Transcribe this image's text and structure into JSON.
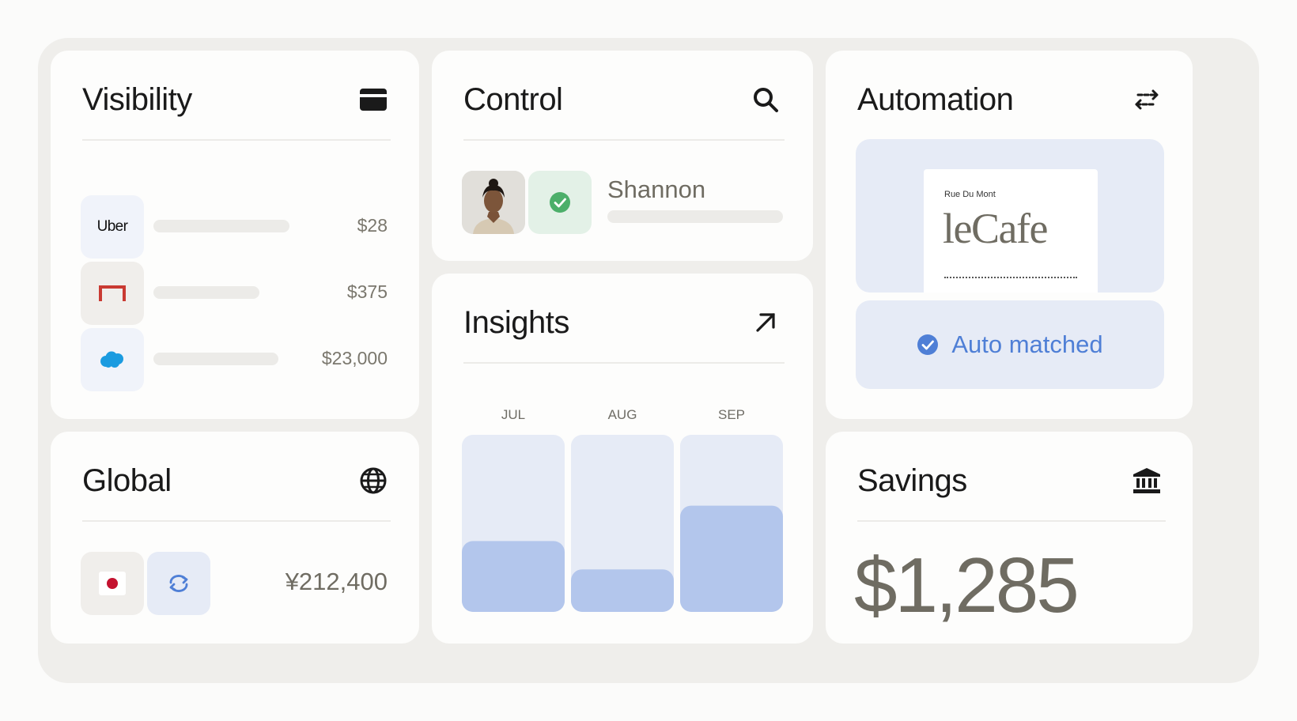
{
  "visibility": {
    "title": "Visibility",
    "icon": "credit-card-icon",
    "rows": [
      {
        "merchant": "Uber",
        "icon": "uber-logo",
        "amount": "$28"
      },
      {
        "merchant": "",
        "icon": "red-bracket-logo",
        "amount": "$375"
      },
      {
        "merchant": "",
        "icon": "salesforce-cloud-logo",
        "amount": "$23,000"
      }
    ]
  },
  "control": {
    "title": "Control",
    "icon": "search-icon",
    "person_name": "Shannon"
  },
  "automation": {
    "title": "Automation",
    "icon": "swap-arrows-icon",
    "receipt_header": "Rue Du Mont",
    "receipt_brand": "leCafe",
    "status": "Auto matched"
  },
  "insights": {
    "title": "Insights",
    "icon": "arrow-up-right-icon"
  },
  "global": {
    "title": "Global",
    "icon": "globe-icon",
    "amount": "¥212,400"
  },
  "savings": {
    "title": "Savings",
    "icon": "bank-icon",
    "amount": "$1,285"
  },
  "colors": {
    "accent_blue": "#4f7fd6",
    "bar_fill": "#b3c6ec",
    "bar_bg": "#e6ebf6",
    "check_green": "#4caf6a"
  },
  "chart_data": {
    "type": "bar",
    "categories": [
      "JUL",
      "AUG",
      "SEP"
    ],
    "values": [
      40,
      24,
      60
    ],
    "ylim": [
      0,
      100
    ],
    "title": "",
    "xlabel": "",
    "ylabel": "",
    "grid": false
  }
}
